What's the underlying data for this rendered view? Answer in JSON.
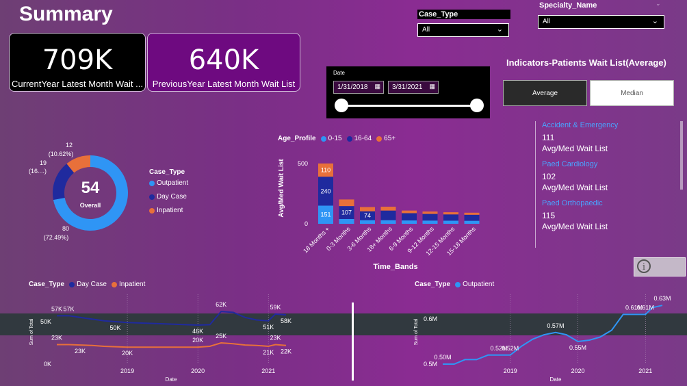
{
  "header": {
    "title": "Summary"
  },
  "kpis": [
    {
      "value": "709K",
      "label": "CurrentYear Latest Month Wait ..."
    },
    {
      "value": "640K",
      "label": "PreviousYear Latest Month Wait List"
    }
  ],
  "slicers": {
    "case_type": {
      "label": "Case_Type",
      "value": "All"
    },
    "specialty": {
      "label": "Specialty_Name",
      "value": "All"
    }
  },
  "date_filter": {
    "label": "Date",
    "start": "1/31/2018",
    "end": "3/31/2021",
    "range": [
      0,
      1
    ]
  },
  "indicators": {
    "title": "Indicators-Patients Wait List(Average)",
    "toggle": [
      "Average",
      "Median"
    ],
    "active_toggle": "Average",
    "items": [
      {
        "name": "Accident & Emergency",
        "value": "111",
        "sub": "Avg/Med Wait List"
      },
      {
        "name": "Paed Cardiology",
        "value": "102",
        "sub": "Avg/Med Wait List"
      },
      {
        "name": "Paed Orthopaedic",
        "value": "115",
        "sub": "Avg/Med Wait List"
      }
    ]
  },
  "donut": {
    "center_value": "54",
    "center_label": "Overall",
    "legend_title": "Case_Type",
    "labels": {
      "inpatient": [
        "12",
        "(10.62%)"
      ],
      "day_case": [
        "19",
        "(16....)"
      ],
      "outpatient": [
        "80",
        "(72.49%)"
      ]
    },
    "legend": [
      {
        "name": "Outpatient",
        "color": "#2f95f5"
      },
      {
        "name": "Day Case",
        "color": "#1f2a9e"
      },
      {
        "name": "Inpatient",
        "color": "#e8703a"
      }
    ]
  },
  "bar_chart": {
    "legend_title": "Age_Profile",
    "series_names": [
      "0-15",
      "16-64",
      "65+"
    ],
    "colors": [
      "#2f95f5",
      "#1f2a9e",
      "#e8703a"
    ],
    "xlabel": "Time_Bands",
    "ylabel": "Avg/Med Wait List"
  },
  "line_left": {
    "legend_title": "Case_Type",
    "legend": [
      {
        "name": "Day Case",
        "color": "#1f2a9e"
      },
      {
        "name": "Inpatient",
        "color": "#e8703a"
      }
    ],
    "ylabel": "Sum of Total",
    "xlabel": "Date"
  },
  "line_right": {
    "legend_title": "Case_Type",
    "legend": [
      {
        "name": "Outpatient",
        "color": "#2f95f5"
      }
    ],
    "ylabel": "Sum of Total",
    "xlabel": "Date"
  },
  "chart_data": [
    {
      "type": "pie",
      "categories": [
        "Outpatient",
        "Day Case",
        "Inpatient"
      ],
      "values": [
        80,
        19,
        12
      ],
      "percent_labels": [
        "72.49%",
        "16....",
        "10.62%"
      ],
      "center_value": 54,
      "colors": [
        "#2f95f5",
        "#1f2a9e",
        "#e8703a"
      ]
    },
    {
      "type": "bar",
      "stacked": true,
      "categories": [
        "18 Months +",
        "0-3 Months",
        "3-6 Months",
        "18+ Months",
        "6-9 Months",
        "9-12 Months",
        "12-15 Months",
        "15-18 Months"
      ],
      "series": [
        {
          "name": "0-15",
          "values": [
            151,
            40,
            30,
            30,
            28,
            27,
            26,
            25
          ]
        },
        {
          "name": "16-64",
          "values": [
            240,
            107,
            74,
            80,
            60,
            55,
            52,
            50
          ]
        },
        {
          "name": "65+",
          "values": [
            110,
            55,
            35,
            32,
            22,
            20,
            18,
            17
          ]
        }
      ],
      "data_labels": {
        "18 Months +": [
          "151",
          "240",
          "110"
        ],
        "0-3 Months": [
          "",
          "107",
          ""
        ],
        "3-6 Months": [
          "",
          "74",
          ""
        ]
      },
      "yticks": [
        0,
        500
      ],
      "ylim": [
        0,
        500
      ],
      "xlabel": "Time_Bands",
      "ylabel": "Avg/Med Wait List"
    },
    {
      "type": "line",
      "x": [
        2018.0,
        2018.17,
        2018.33,
        2018.5,
        2018.67,
        2018.83,
        2019.0,
        2019.17,
        2019.33,
        2019.5,
        2019.67,
        2019.83,
        2020.0,
        2020.17,
        2020.33,
        2020.5,
        2020.67,
        2020.83,
        2021.0,
        2021.1,
        2021.25
      ],
      "series": [
        {
          "name": "Day Case",
          "values": [
            57,
            57,
            55,
            53,
            51,
            50,
            49,
            48.5,
            48,
            47.5,
            47,
            46.5,
            46,
            46.5,
            62,
            61,
            55,
            52,
            51,
            59,
            58
          ]
        },
        {
          "name": "Inpatient",
          "values": [
            23,
            23,
            22.5,
            22,
            21,
            20.5,
            20,
            20,
            20,
            20,
            20,
            20,
            20,
            21,
            25,
            24,
            22.5,
            22,
            21,
            23,
            22
          ]
        }
      ],
      "point_labels": {
        "Day Case": [
          [
            "57K",
            0
          ],
          [
            "57K",
            1
          ],
          [
            "50K",
            5
          ],
          [
            "46K",
            12
          ],
          [
            "62K",
            14
          ],
          [
            "51K",
            18
          ],
          [
            "59K",
            19
          ],
          [
            "58K",
            20
          ]
        ],
        "Inpatient": [
          [
            "23K",
            0
          ],
          [
            "23K",
            2
          ],
          [
            "20K",
            6
          ],
          [
            "20K",
            12
          ],
          [
            "25K",
            14
          ],
          [
            "21K",
            18
          ],
          [
            "23K",
            19
          ],
          [
            "22K",
            20
          ]
        ]
      },
      "yticks": [
        "0K",
        "50K"
      ],
      "xticks": [
        "2019",
        "2020",
        "2021"
      ],
      "xlabel": "Date",
      "ylabel": "Sum of Total"
    },
    {
      "type": "line",
      "x": [
        2018.0,
        2018.17,
        2018.33,
        2018.5,
        2018.67,
        2018.83,
        2019.0,
        2019.17,
        2019.33,
        2019.5,
        2019.67,
        2019.83,
        2020.0,
        2020.17,
        2020.33,
        2020.5,
        2020.67,
        2020.83,
        2021.0,
        2021.1,
        2021.25
      ],
      "series": [
        {
          "name": "Outpatient",
          "values": [
            0.5,
            0.5,
            0.51,
            0.51,
            0.52,
            0.52,
            0.52,
            0.54,
            0.555,
            0.565,
            0.57,
            0.565,
            0.55,
            0.553,
            0.56,
            0.575,
            0.61,
            0.61,
            0.61,
            0.625,
            0.63
          ]
        }
      ],
      "point_labels": {
        "Outpatient": [
          [
            "0.50M",
            0
          ],
          [
            "0.52M",
            5
          ],
          [
            "0.52M",
            6
          ],
          [
            "0.57M",
            10
          ],
          [
            "0.55M",
            12
          ],
          [
            "0.61M",
            17
          ],
          [
            "0.61M",
            18
          ],
          [
            "0.63M",
            20
          ]
        ]
      },
      "yticks": [
        "0.5M",
        "0.6M"
      ],
      "xticks": [
        "2019",
        "2020",
        "2021"
      ],
      "xlabel": "Date",
      "ylabel": "Sum of Total"
    }
  ]
}
